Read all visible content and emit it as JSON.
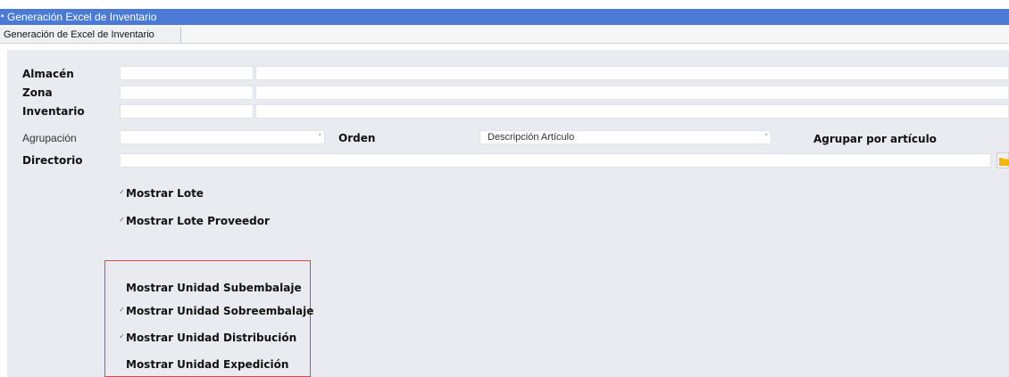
{
  "window": {
    "title": "Generación Excel de Inventario"
  },
  "tabs": [
    {
      "label": "Generación de Excel de Inventario"
    }
  ],
  "form": {
    "almacen": {
      "label": "Almacén",
      "code": "",
      "desc": ""
    },
    "zona": {
      "label": "Zona",
      "code": "",
      "desc": ""
    },
    "inventario": {
      "label": "Inventario",
      "code": "",
      "desc": ""
    },
    "agrupacion": {
      "label": "Agrupación",
      "value": ""
    },
    "orden": {
      "label": "Orden",
      "value": "Descripción Artículo"
    },
    "agrupar_por_articulo": {
      "label": "Agrupar por artículo",
      "checked": false
    },
    "directorio": {
      "label": "Directorio",
      "value": ""
    }
  },
  "options": [
    {
      "label": "Mostrar Lote",
      "checked": true
    },
    {
      "label": "Mostrar Lote Proveedor",
      "checked": true
    },
    {
      "label": "Mostrar Unidad Subembalaje",
      "checked": false
    },
    {
      "label": "Mostrar Unidad Sobreembalaje",
      "checked": true
    },
    {
      "label": "Mostrar Unidad Distribución",
      "checked": true
    },
    {
      "label": "Mostrar Unidad Expedición",
      "checked": false
    }
  ],
  "colors": {
    "titlebar": "#4a7ad6",
    "panel": "#e9ebf1",
    "highlight": "#d94848",
    "folder": "#f5b800"
  },
  "icons": {
    "folder": "folder-icon",
    "dropdown": "chevron-down-icon",
    "check": "checkmark-icon"
  }
}
